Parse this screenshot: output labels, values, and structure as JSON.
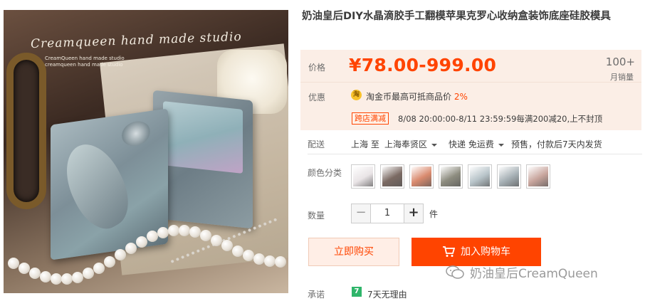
{
  "product_image": {
    "brand_script": "Creamqueen hand made studio",
    "brand_small_1": "CreamQueen hand made studio",
    "brand_small_2": "creamqueen hand made studio"
  },
  "title": "奶油皇后DIY水晶滴胶手工翻模苹果克罗心收纳盒装饰底座硅胶模具",
  "price": {
    "label": "价格",
    "value": "¥78.00-999.00",
    "sales_count": "100+",
    "sales_label": "月销量"
  },
  "promotion": {
    "label": "优惠",
    "coin_icon": "淘",
    "coin_text": "淘金币最高可抵商品价",
    "coin_percent": "2%",
    "tag": "跨店满减",
    "tag_desc": "8/08 20:00:00-8/11 23:59:59每满200减20,上不封顶"
  },
  "shipping": {
    "label": "配送",
    "from": "上海 至",
    "to": "上海奉贤区",
    "method": "快递 免运费",
    "note": "预售，付款后7天内发货"
  },
  "color": {
    "label": "颜色分类",
    "swatch_colors": [
      "#e9e4e6",
      "#7b6a63",
      "#d98a6e",
      "#8d8c7f",
      "#b8c4c9",
      "#a7b1b6",
      "#c8a59d"
    ]
  },
  "quantity": {
    "label": "数量",
    "minus": "−",
    "value": "1",
    "plus": "+",
    "unit": "件"
  },
  "actions": {
    "buy_now": "立即购买",
    "add_to_cart": "加入购物车"
  },
  "watermark": "奶油皇后CreamQueen",
  "promise": {
    "label": "承诺",
    "icon": "7",
    "text": "7天无理由"
  },
  "colors": {
    "accent": "#ff4400",
    "price_bg": "#fbeee6"
  }
}
